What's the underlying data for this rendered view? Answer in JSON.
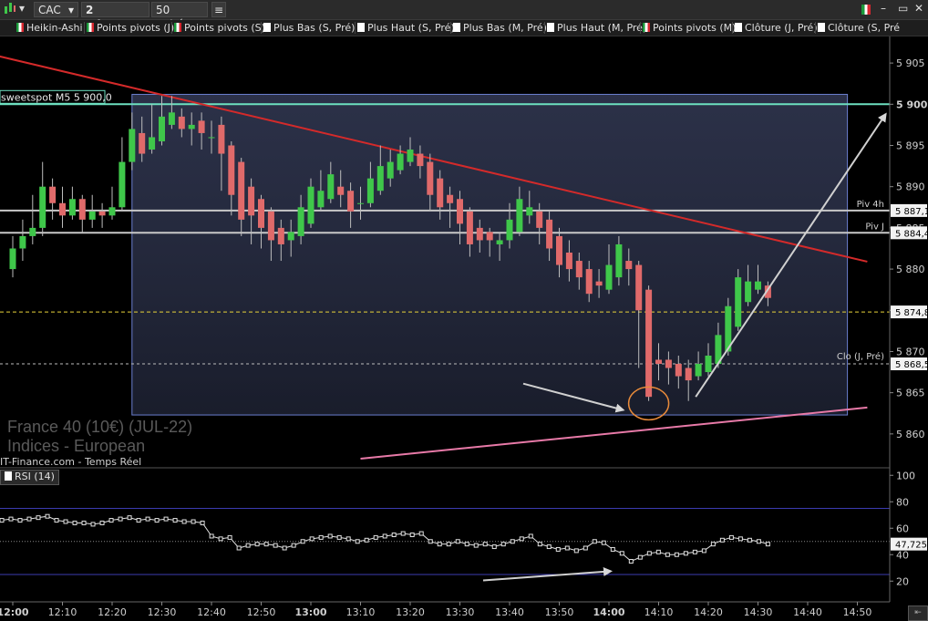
{
  "toolbar": {
    "symbol": "CAC",
    "interval": "2 minutes",
    "units": "50 unités"
  },
  "indicators": [
    {
      "label": "Heikin-Ashi",
      "flag": "it"
    },
    {
      "label": "Points pivots (J)",
      "flag": "it"
    },
    {
      "label": "Points pivots (S)",
      "flag": "it"
    },
    {
      "label": "Plus Bas (S, Pré)",
      "flag": "w"
    },
    {
      "label": "Plus Haut (S, Pré)",
      "flag": "w"
    },
    {
      "label": "Plus Bas (M, Pré)",
      "flag": "w"
    },
    {
      "label": "Plus Haut (M, Pré)",
      "flag": "w"
    },
    {
      "label": "Points pivots (M)",
      "flag": "it"
    },
    {
      "label": "Clôture (J, Pré)",
      "flag": "w"
    },
    {
      "label": "Clôture (S, Pré",
      "flag": "w"
    }
  ],
  "watermark": {
    "line1": "France 40 (10€) (JUL-22)",
    "line2": "Indices - European",
    "source": "IT-Finance.com - Temps Réel"
  },
  "colors": {
    "up": "#3fc74a",
    "down": "#e06a6a",
    "trend": "#d42a2a",
    "support": "#e87aa8",
    "sweetspot": "#6de0c0",
    "box": "#6b7fd0"
  },
  "chart_data": [
    {
      "type": "candlestick",
      "subtype": "heikin-ashi",
      "ylim": [
        5856,
        5908
      ],
      "y_ticks": [
        5860,
        5865,
        5870,
        5875,
        5880,
        5885,
        5890,
        5895,
        5900,
        5905
      ],
      "y_tick_labels": [
        "5 860",
        "5 865",
        "5 870",
        "5 875",
        "5 880",
        "5 885",
        "5 890",
        "5 895",
        "5 900",
        "5 905"
      ],
      "x_ticks": [
        "12:00",
        "12:10",
        "12:20",
        "12:30",
        "12:40",
        "12:50",
        "13:00",
        "13:10",
        "13:20",
        "13:30",
        "13:40",
        "13:50",
        "14:00",
        "14:10",
        "14:20",
        "14:30",
        "14:40",
        "14:50"
      ],
      "x_major": [
        "12:00",
        "13:00",
        "14:00"
      ],
      "candles": [
        {
          "t": "12:00",
          "o": 5880.0,
          "c": 5882.5,
          "h": 5884.0,
          "l": 5879.0
        },
        {
          "t": "12:02",
          "o": 5882.5,
          "c": 5884.0,
          "h": 5886.0,
          "l": 5881.0
        },
        {
          "t": "12:04",
          "o": 5884.0,
          "c": 5885.0,
          "h": 5889.0,
          "l": 5883.0
        },
        {
          "t": "12:06",
          "o": 5885.0,
          "c": 5890.0,
          "h": 5893.0,
          "l": 5884.0
        },
        {
          "t": "12:08",
          "o": 5890.0,
          "c": 5888.0,
          "h": 5891.0,
          "l": 5886.0
        },
        {
          "t": "12:10",
          "o": 5888.0,
          "c": 5886.5,
          "h": 5890.0,
          "l": 5885.0
        },
        {
          "t": "12:12",
          "o": 5886.5,
          "c": 5888.5,
          "h": 5890.0,
          "l": 5886.0
        },
        {
          "t": "12:14",
          "o": 5888.5,
          "c": 5886.0,
          "h": 5889.0,
          "l": 5884.5
        },
        {
          "t": "12:16",
          "o": 5886.0,
          "c": 5887.0,
          "h": 5889.0,
          "l": 5885.0
        },
        {
          "t": "12:18",
          "o": 5887.0,
          "c": 5886.5,
          "h": 5888.0,
          "l": 5885.0
        },
        {
          "t": "12:20",
          "o": 5886.5,
          "c": 5887.5,
          "h": 5890.0,
          "l": 5886.0
        },
        {
          "t": "12:22",
          "o": 5887.5,
          "c": 5893.0,
          "h": 5896.0,
          "l": 5887.0
        },
        {
          "t": "12:24",
          "o": 5893.0,
          "c": 5897.0,
          "h": 5899.0,
          "l": 5892.0
        },
        {
          "t": "12:26",
          "o": 5896.5,
          "c": 5894.0,
          "h": 5898.5,
          "l": 5893.0
        },
        {
          "t": "12:28",
          "o": 5894.5,
          "c": 5896.0,
          "h": 5900.0,
          "l": 5894.0
        },
        {
          "t": "12:30",
          "o": 5895.5,
          "c": 5898.5,
          "h": 5901.0,
          "l": 5895.0
        },
        {
          "t": "12:32",
          "o": 5897.5,
          "c": 5899.0,
          "h": 5901.0,
          "l": 5897.0
        },
        {
          "t": "12:34",
          "o": 5898.5,
          "c": 5897.0,
          "h": 5899.5,
          "l": 5896.0
        },
        {
          "t": "12:36",
          "o": 5897.0,
          "c": 5897.5,
          "h": 5899.0,
          "l": 5895.0
        },
        {
          "t": "12:38",
          "o": 5898.0,
          "c": 5896.5,
          "h": 5899.0,
          "l": 5894.5
        },
        {
          "t": "12:40",
          "o": 5896.0,
          "c": 5896.0,
          "h": 5898.0,
          "l": 5894.0
        },
        {
          "t": "12:42",
          "o": 5897.5,
          "c": 5894.0,
          "h": 5898.5,
          "l": 5889.5
        },
        {
          "t": "12:44",
          "o": 5895.0,
          "c": 5889.0,
          "h": 5895.5,
          "l": 5886.5
        },
        {
          "t": "12:46",
          "o": 5893.0,
          "c": 5886.0,
          "h": 5893.5,
          "l": 5884.0
        },
        {
          "t": "12:48",
          "o": 5890.0,
          "c": 5886.5,
          "h": 5891.0,
          "l": 5883.0
        },
        {
          "t": "12:50",
          "o": 5888.5,
          "c": 5885.0,
          "h": 5889.0,
          "l": 5882.5
        },
        {
          "t": "12:52",
          "o": 5887.0,
          "c": 5883.5,
          "h": 5887.5,
          "l": 5881.0
        },
        {
          "t": "12:54",
          "o": 5885.0,
          "c": 5883.0,
          "h": 5886.0,
          "l": 5881.0
        },
        {
          "t": "12:56",
          "o": 5883.5,
          "c": 5884.5,
          "h": 5886.0,
          "l": 5881.5
        },
        {
          "t": "12:58",
          "o": 5884.0,
          "c": 5887.5,
          "h": 5889.0,
          "l": 5883.0
        },
        {
          "t": "13:00",
          "o": 5885.5,
          "c": 5890.0,
          "h": 5891.0,
          "l": 5885.0
        },
        {
          "t": "13:02",
          "o": 5887.5,
          "c": 5889.5,
          "h": 5892.0,
          "l": 5887.0
        },
        {
          "t": "13:04",
          "o": 5888.5,
          "c": 5891.5,
          "h": 5893.0,
          "l": 5888.0
        },
        {
          "t": "13:06",
          "o": 5890.0,
          "c": 5889.0,
          "h": 5892.0,
          "l": 5887.5
        },
        {
          "t": "13:08",
          "o": 5889.5,
          "c": 5887.0,
          "h": 5890.5,
          "l": 5885.0
        },
        {
          "t": "13:10",
          "o": 5888.0,
          "c": 5888.0,
          "h": 5890.0,
          "l": 5886.0
        },
        {
          "t": "13:12",
          "o": 5888.0,
          "c": 5891.0,
          "h": 5893.0,
          "l": 5887.5
        },
        {
          "t": "13:14",
          "o": 5889.5,
          "c": 5892.5,
          "h": 5895.0,
          "l": 5889.0
        },
        {
          "t": "13:16",
          "o": 5891.0,
          "c": 5893.0,
          "h": 5894.5,
          "l": 5890.0
        },
        {
          "t": "13:18",
          "o": 5892.0,
          "c": 5894.0,
          "h": 5895.0,
          "l": 5891.5
        },
        {
          "t": "13:20",
          "o": 5893.0,
          "c": 5894.5,
          "h": 5896.0,
          "l": 5892.5
        },
        {
          "t": "13:22",
          "o": 5894.0,
          "c": 5892.5,
          "h": 5895.0,
          "l": 5891.0
        },
        {
          "t": "13:24",
          "o": 5893.0,
          "c": 5889.0,
          "h": 5894.0,
          "l": 5887.0
        },
        {
          "t": "13:26",
          "o": 5891.0,
          "c": 5887.5,
          "h": 5892.0,
          "l": 5886.0
        },
        {
          "t": "13:28",
          "o": 5889.0,
          "c": 5888.0,
          "h": 5890.0,
          "l": 5885.0
        },
        {
          "t": "13:30",
          "o": 5888.5,
          "c": 5885.5,
          "h": 5889.5,
          "l": 5883.0
        },
        {
          "t": "13:32",
          "o": 5887.0,
          "c": 5883.0,
          "h": 5887.5,
          "l": 5881.5
        },
        {
          "t": "13:34",
          "o": 5885.0,
          "c": 5883.5,
          "h": 5886.0,
          "l": 5882.0
        },
        {
          "t": "13:36",
          "o": 5884.5,
          "c": 5883.5,
          "h": 5885.0,
          "l": 5881.5
        },
        {
          "t": "13:38",
          "o": 5883.0,
          "c": 5883.5,
          "h": 5884.5,
          "l": 5881.0
        },
        {
          "t": "13:40",
          "o": 5883.5,
          "c": 5886.0,
          "h": 5888.0,
          "l": 5882.5
        },
        {
          "t": "13:42",
          "o": 5884.5,
          "c": 5888.5,
          "h": 5890.0,
          "l": 5884.0
        },
        {
          "t": "13:44",
          "o": 5886.5,
          "c": 5887.5,
          "h": 5889.5,
          "l": 5885.5
        },
        {
          "t": "13:46",
          "o": 5887.0,
          "c": 5885.0,
          "h": 5888.0,
          "l": 5883.0
        },
        {
          "t": "13:48",
          "o": 5886.0,
          "c": 5882.5,
          "h": 5887.0,
          "l": 5881.0
        },
        {
          "t": "13:50",
          "o": 5884.0,
          "c": 5880.5,
          "h": 5885.0,
          "l": 5879.0
        },
        {
          "t": "13:52",
          "o": 5882.0,
          "c": 5880.0,
          "h": 5883.5,
          "l": 5878.5
        },
        {
          "t": "13:54",
          "o": 5881.0,
          "c": 5879.0,
          "h": 5882.0,
          "l": 5877.5
        },
        {
          "t": "13:56",
          "o": 5880.0,
          "c": 5877.0,
          "h": 5881.0,
          "l": 5876.0
        },
        {
          "t": "13:58",
          "o": 5878.5,
          "c": 5878.0,
          "h": 5880.0,
          "l": 5876.5
        },
        {
          "t": "14:00",
          "o": 5877.5,
          "c": 5880.5,
          "h": 5883.0,
          "l": 5877.0
        },
        {
          "t": "14:02",
          "o": 5879.0,
          "c": 5883.0,
          "h": 5884.0,
          "l": 5878.0
        },
        {
          "t": "14:04",
          "o": 5881.0,
          "c": 5880.0,
          "h": 5882.5,
          "l": 5878.0
        },
        {
          "t": "14:06",
          "o": 5880.5,
          "c": 5875.0,
          "h": 5881.0,
          "l": 5868.0
        },
        {
          "t": "14:08",
          "o": 5877.5,
          "c": 5864.5,
          "h": 5878.0,
          "l": 5864.0
        },
        {
          "t": "14:10",
          "o": 5869.0,
          "c": 5868.5,
          "h": 5871.0,
          "l": 5866.5
        },
        {
          "t": "14:12",
          "o": 5869.0,
          "c": 5868.0,
          "h": 5870.0,
          "l": 5866.0
        },
        {
          "t": "14:14",
          "o": 5868.5,
          "c": 5867.0,
          "h": 5869.5,
          "l": 5865.5
        },
        {
          "t": "14:16",
          "o": 5868.0,
          "c": 5866.5,
          "h": 5869.0,
          "l": 5864.0
        },
        {
          "t": "14:18",
          "o": 5867.0,
          "c": 5868.5,
          "h": 5870.0,
          "l": 5866.5
        },
        {
          "t": "14:20",
          "o": 5867.5,
          "c": 5869.5,
          "h": 5871.0,
          "l": 5867.0
        },
        {
          "t": "14:22",
          "o": 5868.5,
          "c": 5872.0,
          "h": 5873.5,
          "l": 5868.0
        },
        {
          "t": "14:24",
          "o": 5870.0,
          "c": 5875.5,
          "h": 5876.5,
          "l": 5869.5
        },
        {
          "t": "14:26",
          "o": 5873.0,
          "c": 5879.0,
          "h": 5880.0,
          "l": 5872.5
        },
        {
          "t": "14:28",
          "o": 5876.0,
          "c": 5878.5,
          "h": 5880.5,
          "l": 5875.5
        },
        {
          "t": "14:30",
          "o": 5877.5,
          "c": 5878.5,
          "h": 5880.5,
          "l": 5877.0
        },
        {
          "t": "14:32",
          "o": 5878.0,
          "c": 5876.5,
          "h": 5878.5,
          "l": 5875.5
        }
      ],
      "lines": {
        "sweetspot": {
          "label": "sweetspot M5 5 900,0",
          "value": 5900.0
        },
        "piv_4h": {
          "label": "Piv 4h",
          "value": 5887.1,
          "price_label": "5 887,1"
        },
        "piv_j": {
          "label": "Piv J",
          "value": 5884.4,
          "price_label": "5 884,4"
        },
        "level_874": {
          "value": 5874.8,
          "price_label": "5 874,8"
        },
        "clo_j": {
          "label": "Clo (J, Pré)",
          "value": 5868.5,
          "price_label": "5 868,5"
        }
      },
      "trendline_resistance": {
        "from": {
          "t": "11:56",
          "v": 5906.0
        },
        "to": {
          "t": "14:52",
          "v": 5880.9
        }
      },
      "trendline_support": {
        "from": {
          "t": "13:10",
          "v": 5857.0
        },
        "to": {
          "t": "14:52",
          "v": 5863.2
        }
      },
      "box": {
        "from_t": "12:24",
        "to_t": "14:48",
        "high": 5901.2,
        "low": 5862.3
      }
    },
    {
      "type": "line",
      "title": "RSI (14)",
      "ylim": [
        5,
        105
      ],
      "y_ticks": [
        20,
        40,
        60,
        80,
        100
      ],
      "y_tick_labels": [
        "20",
        "40",
        "60",
        "80",
        "100"
      ],
      "current_value_label": "47,725",
      "bands": [
        75,
        25
      ],
      "midline": 50,
      "values": [
        66,
        67,
        66,
        67,
        68,
        69,
        66,
        65,
        64,
        64,
        63,
        64,
        66,
        67,
        68,
        66,
        67,
        66,
        67,
        66,
        65,
        65,
        64,
        54,
        52,
        53,
        45,
        47,
        48,
        48,
        47,
        45,
        47,
        50,
        52,
        53,
        54,
        53,
        52,
        50,
        51,
        53,
        54,
        55,
        56,
        55,
        56,
        50,
        48,
        48,
        50,
        48,
        47,
        48,
        46,
        48,
        50,
        52,
        54,
        48,
        46,
        44,
        45,
        43,
        45,
        50,
        49,
        44,
        41,
        35,
        38,
        41,
        42,
        40,
        40,
        41,
        42,
        43,
        48,
        51,
        53,
        52,
        51,
        50,
        48
      ]
    }
  ]
}
